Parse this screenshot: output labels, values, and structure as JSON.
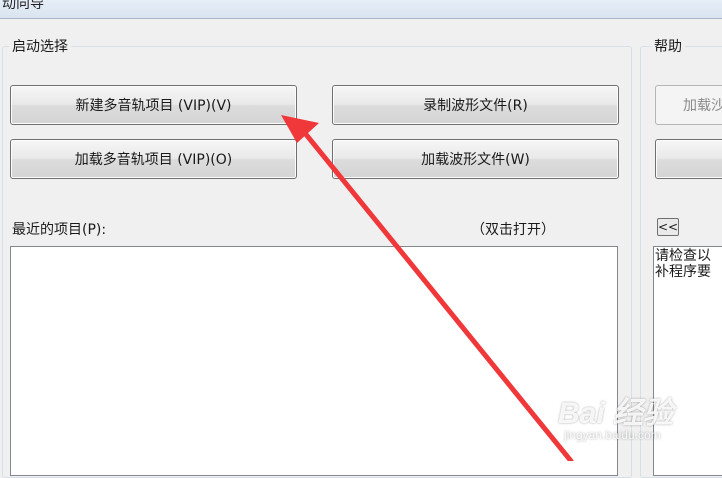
{
  "window": {
    "title_fragment": "动向导"
  },
  "startup_group": {
    "label": "启动选择"
  },
  "help_group": {
    "label": "帮助"
  },
  "buttons": {
    "new_multitrack": "新建多音轨项目 (VIP)(V)",
    "record_waveform": "录制波形文件(R)",
    "load_multitrack": "加载多音轨项目 (VIP)(O)",
    "load_waveform": "加载波形文件(W)",
    "help_load": "加载沙",
    "help_second": "",
    "collapse": "<<"
  },
  "recent": {
    "label": "最近的项目(P):",
    "hint": "（双击打开）",
    "items": []
  },
  "help_text": [
    "请检查以",
    "补程序要"
  ],
  "watermark": {
    "brand": "Bai 经验",
    "sub": "",
    "url": "jingyan.baidu.com"
  },
  "colors": {
    "annotation_arrow": "#f0383a"
  }
}
